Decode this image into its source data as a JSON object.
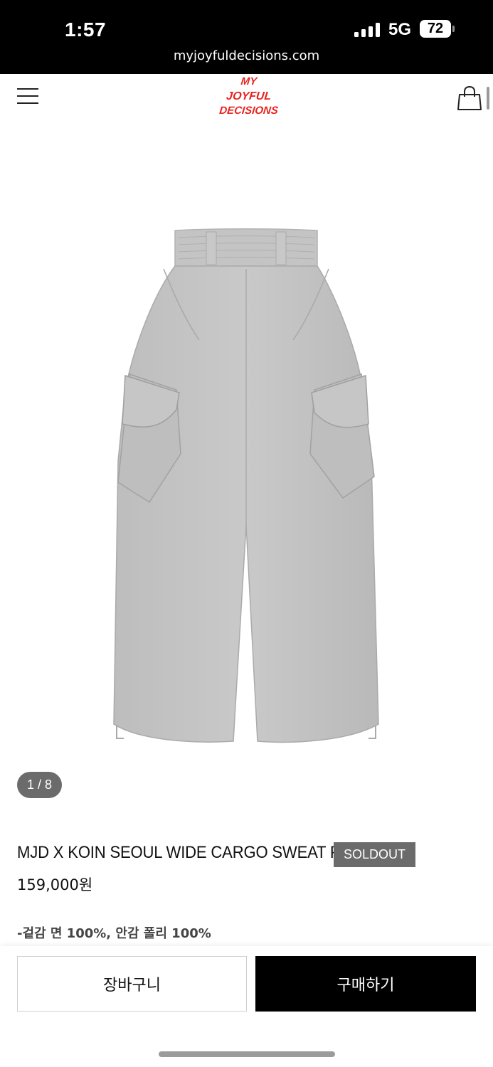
{
  "status_bar": {
    "time": "1:57",
    "network": "5G",
    "battery": "72",
    "url": "myjoyfuldecisions.com"
  },
  "header": {
    "logo_lines": [
      "MY",
      "JOYFUL",
      "DECISIONS"
    ],
    "logo_color": "#e8231f",
    "menu_icon": "hamburger-menu-icon",
    "cart_icon": "shopping-bag-icon"
  },
  "gallery": {
    "counter": "1 / 8",
    "image_subject": "grey wide cargo sweat pants"
  },
  "product": {
    "title": "MJD X KOIN SEOUL WIDE CARGO SWEAT PANTS",
    "badge": "SOLDOUT",
    "price": "159,000원",
    "material": "-겉감 면 100%, 안감 폴리 100%"
  },
  "actions": {
    "cart_label": "장바구니",
    "buy_label": "구매하기"
  }
}
